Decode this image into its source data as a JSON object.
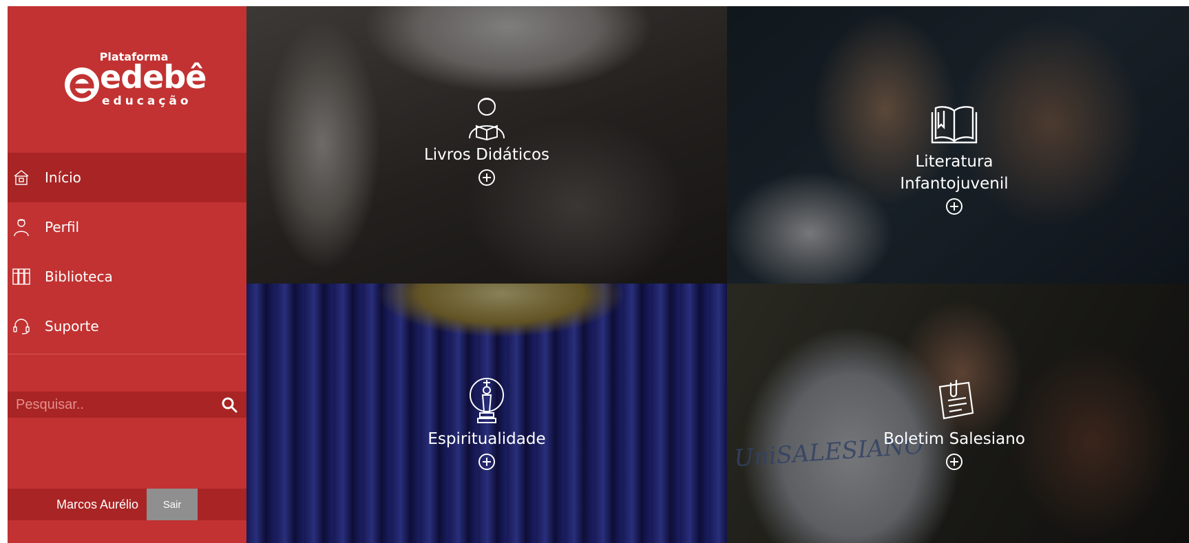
{
  "brand": {
    "top": "Plataforma",
    "main": "edebê",
    "sub": "educação"
  },
  "nav": [
    {
      "label": "Início",
      "icon": "home-icon",
      "active": true
    },
    {
      "label": "Perfil",
      "icon": "user-icon",
      "active": false
    },
    {
      "label": "Biblioteca",
      "icon": "library-icon",
      "active": false
    },
    {
      "label": "Suporte",
      "icon": "headset-icon",
      "active": false
    }
  ],
  "search": {
    "placeholder": "Pesquisar..",
    "icon": "search-icon"
  },
  "user": {
    "name": "Marcos Aurélio",
    "logout_label": "Sair"
  },
  "tiles": [
    {
      "label": "Livros Didáticos",
      "icon": "reader-icon"
    },
    {
      "label_line1": "Literatura",
      "label_line2": "Infantojuvenil",
      "icon": "open-book-icon"
    },
    {
      "label": "Espiritualidade",
      "icon": "chess-king-icon"
    },
    {
      "label": "Boletim Salesiano",
      "icon": "note-icon"
    }
  ],
  "jersey_text": "UniSALESIANO",
  "colors": {
    "sidebar": "#c23232",
    "sidebar_dark": "#a92424",
    "logout_button": "#8f8f8f"
  }
}
